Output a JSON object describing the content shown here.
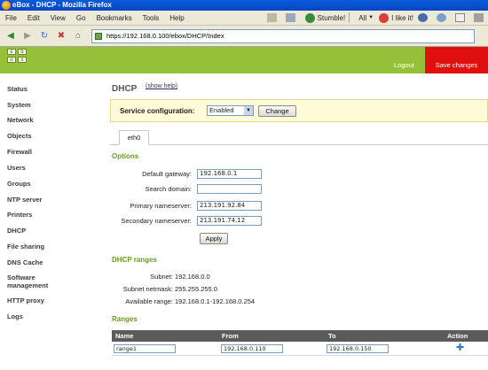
{
  "window": {
    "title": "eBox - DHCP - Mozilla Firefox"
  },
  "menubar": {
    "items": [
      "File",
      "Edit",
      "View",
      "Go",
      "Bookmarks",
      "Tools",
      "Help"
    ],
    "stumble_label": "Stumble!",
    "all_label": "All",
    "like_label": "I like it!"
  },
  "navbar": {
    "url": "https://192.168.0.100/ebox/DHCP/Index"
  },
  "header": {
    "logo_letters": [
      "e",
      "b",
      "o",
      "x"
    ],
    "logout_label": "Logout",
    "save_label": "Save changes"
  },
  "sidebar": {
    "items": [
      "Status",
      "System",
      "Network",
      "Objects",
      "Firewall",
      "Users",
      "Groups",
      "NTP server",
      "Printers",
      "DHCP",
      "File sharing",
      "DNS Cache",
      "Software management",
      "HTTP proxy",
      "Logs"
    ]
  },
  "page": {
    "title": "DHCP",
    "help_link": "(show help)",
    "service": {
      "label": "Service configuration:",
      "selected": "Enabled",
      "change_label": "Change"
    },
    "tab_label": "eth0",
    "options": {
      "heading": "Options",
      "fields": [
        {
          "label": "Default gateway:",
          "value": "192.168.0.1"
        },
        {
          "label": "Search domain:",
          "value": ""
        },
        {
          "label": "Primary nameserver:",
          "value": "213.191.92.84"
        },
        {
          "label": "Secondary nameserver:",
          "value": "213.191.74.12"
        }
      ],
      "apply_label": "Apply"
    },
    "dhcp_ranges": {
      "heading": "DHCP ranges",
      "rows": [
        {
          "label": "Subnet:",
          "value": "192.168.0.0"
        },
        {
          "label": "Subnet netmask:",
          "value": "255.255.255.0"
        },
        {
          "label": "Available range:",
          "value": "192.168.0.1-192.168.0.254"
        }
      ]
    },
    "ranges": {
      "heading": "Ranges",
      "columns": [
        "Name",
        "From",
        "To",
        "Action"
      ],
      "row": {
        "name": "range1",
        "from": "192.168.0.110",
        "to": "192.168.0.150"
      }
    }
  }
}
